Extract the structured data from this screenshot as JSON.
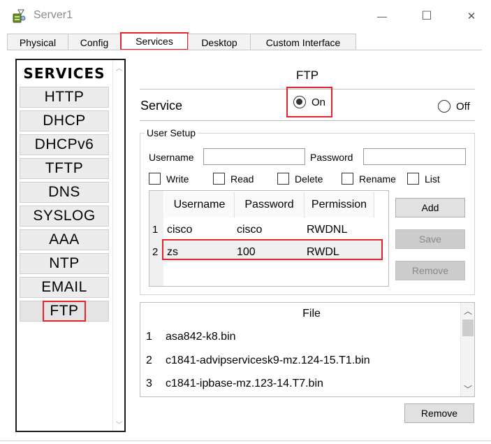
{
  "window": {
    "title": "Server1",
    "controls": {
      "minimize": "—",
      "maximize": "☐",
      "close": "✕"
    }
  },
  "tabs": [
    {
      "label": "Physical",
      "active": false
    },
    {
      "label": "Config",
      "active": false
    },
    {
      "label": "Services",
      "active": true
    },
    {
      "label": "Desktop",
      "active": false
    },
    {
      "label": "Custom Interface",
      "active": false
    }
  ],
  "sidebar": {
    "header": "SERVICES",
    "items": [
      "HTTP",
      "DHCP",
      "DHCPv6",
      "TFTP",
      "DNS",
      "SYSLOG",
      "AAA",
      "NTP",
      "EMAIL",
      "FTP"
    ],
    "selected": "FTP"
  },
  "ftp": {
    "title": "FTP",
    "service_label": "Service",
    "on_label": "On",
    "off_label": "Off",
    "service_state": "On"
  },
  "user_setup": {
    "legend": "User Setup",
    "username_label": "Username",
    "password_label": "Password",
    "username_value": "",
    "password_value": "",
    "permissions": [
      "Write",
      "Read",
      "Delete",
      "Rename",
      "List"
    ],
    "columns": [
      "Username",
      "Password",
      "Permission"
    ],
    "rows": [
      {
        "num": "1",
        "username": "cisco",
        "password": "cisco",
        "permission": "RWDNL"
      },
      {
        "num": "2",
        "username": "zs",
        "password": "100",
        "permission": "RWDL"
      }
    ],
    "add_label": "Add",
    "save_label": "Save",
    "remove_label": "Remove"
  },
  "files": {
    "header": "File",
    "rows": [
      {
        "num": "1",
        "name": "asa842-k8.bin"
      },
      {
        "num": "2",
        "name": "c1841-advipservicesk9-mz.124-15.T1.bin"
      },
      {
        "num": "3",
        "name": "c1841-ipbase-mz.123-14.T7.bin"
      }
    ],
    "remove_label": "Remove"
  },
  "colors": {
    "highlight": "#e3242b",
    "tab_bg": "#f3f3f3",
    "service_item_bg": "#ececec"
  }
}
